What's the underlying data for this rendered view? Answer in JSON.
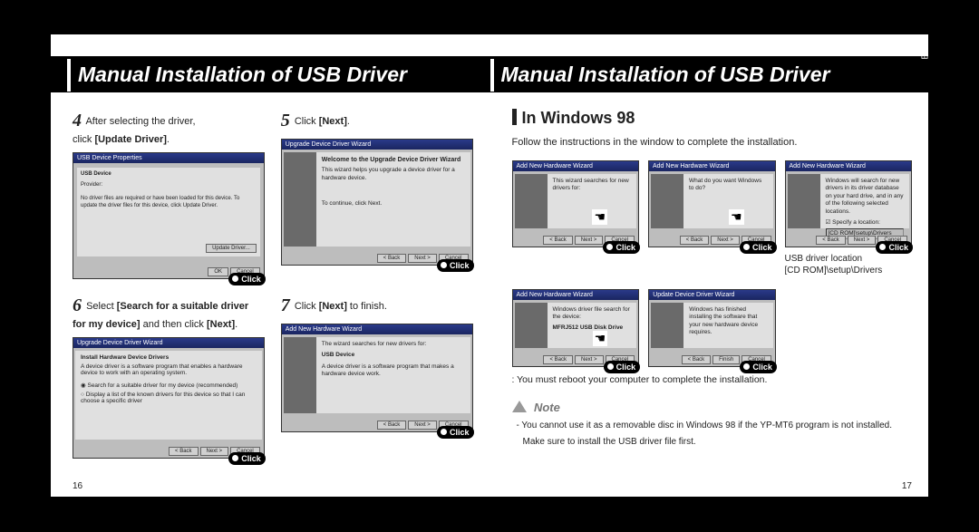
{
  "left": {
    "title": "Manual Installation of USB Driver",
    "step4": {
      "num": "4",
      "text_a": "After selecting the driver,",
      "text_b": "click ",
      "bold": "[Update Driver]",
      "text_c": ".",
      "wiz_title": "USB Device Properties",
      "wiz_head": "USB Device",
      "wiz_body1": "Provider:",
      "wiz_body2": "No driver files are required or have been loaded for this device. To update the driver files for this device, click Update Driver.",
      "btn_update": "Update Driver...",
      "btn_ok": "OK",
      "btn_cancel": "Cancel",
      "click": "Click"
    },
    "step5": {
      "num": "5",
      "text_a": "Click ",
      "bold": "[Next]",
      "text_b": ".",
      "wiz_title": "Upgrade Device Driver Wizard",
      "wiz_head": "Welcome to the Upgrade Device Driver Wizard",
      "wiz_body": "This wizard helps you upgrade a device driver for a hardware device.",
      "wiz_foot": "To continue, click Next.",
      "btn_back": "< Back",
      "btn_next": "Next >",
      "btn_cancel": "Cancel",
      "click": "Click"
    },
    "step6": {
      "num": "6",
      "text_a": "Select  ",
      "bold": "[Search for a suitable driver for my device]",
      "text_b": " and then click ",
      "bold2": "[Next]",
      "text_c": ".",
      "wiz_title": "Upgrade Device Driver Wizard",
      "wiz_head": "Install Hardware Device Drivers",
      "wiz_body": "A device driver is a software program that enables a hardware device to work with an operating system.",
      "opt1": "Search for a suitable driver for my device (recommended)",
      "opt2": "Display a list of the known drivers for this device so that I can choose a specific driver",
      "btn_back": "< Back",
      "btn_next": "Next >",
      "btn_cancel": "Cancel",
      "click": "Click"
    },
    "step7": {
      "num": "7",
      "text_a": "Click ",
      "bold": "[Next]",
      "text_b": " to finish.",
      "wiz_title": "Add New Hardware Wizard",
      "wiz_body1": "The wizard searches for new drivers for:",
      "wiz_body2": "USB Device",
      "wiz_body3": "A device driver is a software program that makes a hardware device work.",
      "btn_back": "< Back",
      "btn_next": "Next >",
      "btn_cancel": "Cancel",
      "click": "Click"
    },
    "page_num": "16"
  },
  "right": {
    "title": "Manual Installation of USB Driver",
    "section": "In Windows 98",
    "sub": "Follow the instructions in the window to complete the installation.",
    "shots": {
      "a": {
        "title": "Add New Hardware Wizard",
        "body": "This wizard searches for new drivers for:",
        "click": "Click"
      },
      "b": {
        "title": "Add New Hardware Wizard",
        "body": "What do you want Windows to do?",
        "click": "Click"
      },
      "c": {
        "title": "Add New Hardware Wizard",
        "body": "Windows will search for new drivers in its driver database on your hard drive, and in any of the following selected locations.",
        "opt": "Specify a location:",
        "path": "[CD ROM]\\setup\\Drivers",
        "click": "Click"
      },
      "d": {
        "title": "Add New Hardware Wizard",
        "body": "Windows driver file search for the device:",
        "item": "MFRJ512 USB Disk Drive",
        "click": "Click"
      },
      "e": {
        "title": "Update Device Driver Wizard",
        "body": "Windows has finished installing the software that your new hardware device requires.",
        "click": "Click"
      }
    },
    "loc_label1": "USB driver location",
    "loc_label2": "[CD ROM]\\setup\\Drivers",
    "reboot": ": You must reboot your computer to complete the installation.",
    "note_head": "Note",
    "note1": "- You cannot use it as a removable disc in Windows 98 if the YP-MT6 program is not installed.",
    "note2": "Make sure to install the USB driver file first.",
    "page_num": "17",
    "lang": "ENG",
    "btn_back": "< Back",
    "btn_next": "Next >",
    "btn_finish": "Finish",
    "btn_cancel": "Cancel"
  }
}
